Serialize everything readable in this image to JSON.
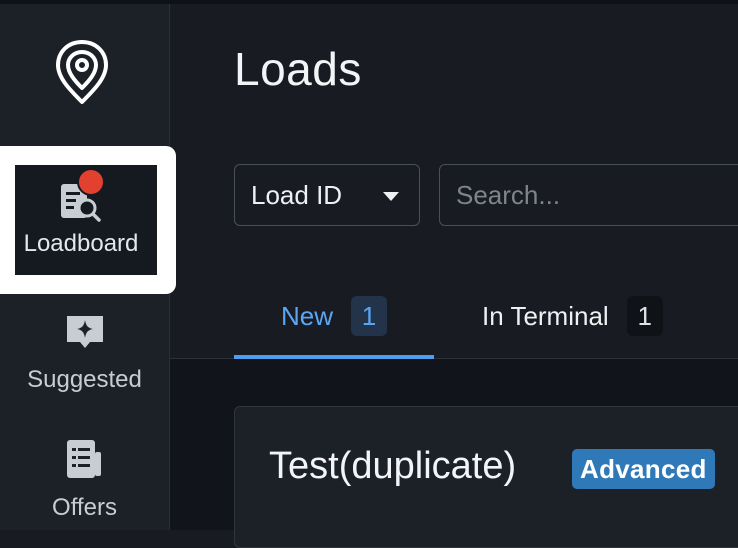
{
  "sidebar": {
    "logo_icon": "map-pin-logo-icon",
    "items": [
      {
        "label": "Loadboard",
        "icon": "loadboard-search-icon",
        "active": true,
        "has_notification": true
      },
      {
        "label": "Suggested",
        "icon": "sparkle-chat-icon",
        "active": false
      },
      {
        "label": "Offers",
        "icon": "document-list-icon",
        "active": false
      }
    ]
  },
  "header": {
    "title": "Loads"
  },
  "filters": {
    "select": {
      "value": "Load ID",
      "icon": "caret-down-icon"
    },
    "search": {
      "placeholder": "Search..."
    }
  },
  "tabs": [
    {
      "label": "New",
      "count": "1",
      "active": true
    },
    {
      "label": "In Terminal",
      "count": "1",
      "active": false
    }
  ],
  "cards": [
    {
      "title": "Test(duplicate)",
      "tag": "Advanced"
    }
  ],
  "colors": {
    "accent": "#4f9df0",
    "notification": "#e2412f",
    "tag": "#2f79b9",
    "background": "#181c22"
  }
}
